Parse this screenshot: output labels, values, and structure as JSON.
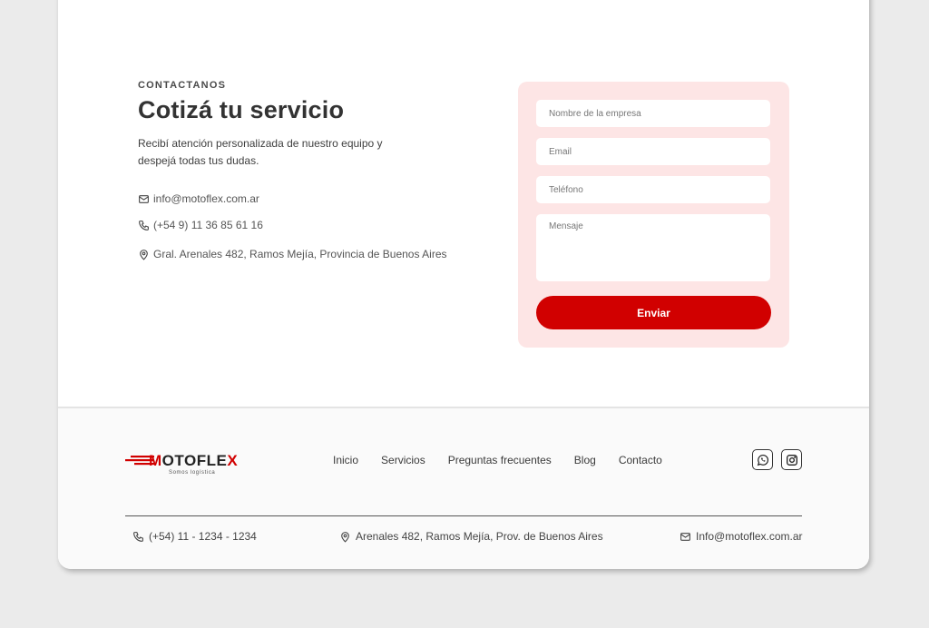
{
  "contact": {
    "eyebrow": "CONTACTANOS",
    "title": "Cotizá tu servicio",
    "lead": "Recibí atención personalizada de nuestro equipo y despejá todas tus dudas.",
    "email": "info@motoflex.com.ar",
    "phone": "(+54 9) 11 36 85 61 16",
    "address": "Gral. Arenales 482, Ramos Mejía, Provincia de Buenos Aires"
  },
  "form": {
    "company_placeholder": "Nombre de la empresa",
    "email_placeholder": "Email",
    "phone_placeholder": "Teléfono",
    "message_placeholder": "Mensaje",
    "submit_label": "Enviar"
  },
  "footer": {
    "logo": {
      "prefix": "M",
      "word": "OTOFLEX",
      "red_letter": "X",
      "tagline": "Somos logística"
    },
    "nav": [
      {
        "label": "Inicio"
      },
      {
        "label": "Servicios"
      },
      {
        "label": "Preguntas frecuentes"
      },
      {
        "label": "Blog"
      },
      {
        "label": "Contacto"
      }
    ],
    "social": [
      {
        "icon": "whatsapp-icon"
      },
      {
        "icon": "instagram-icon"
      }
    ],
    "phone": "(+54) 11 - 1234 - 1234",
    "address": "Arenales 482, Ramos Mejía, Prov. de Buenos Aires",
    "email": "Info@motoflex.com.ar"
  },
  "colors": {
    "accent": "#d10000",
    "form_bg": "#fde5e5",
    "page_bg": "#ebebeb",
    "footer_bg": "#fafafa"
  }
}
